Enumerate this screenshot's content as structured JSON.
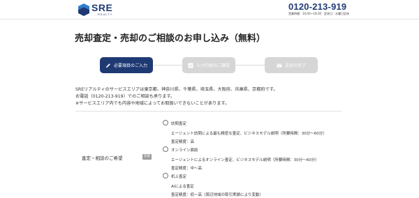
{
  "header": {
    "logo_text": "SRE",
    "logo_sub": "REALTY",
    "tel_number": "0120-213-919",
    "tel_hours": "営業時間：10:00〜18:30　定休日：水曜日定休"
  },
  "page_title": "売却査定・売却のご相談のお申し込み（無料）",
  "steps": [
    {
      "label": "必要項目のご入力",
      "icon": "pencil-icon",
      "active": true
    },
    {
      "label": "入力内容のご確認",
      "icon": "check-icon",
      "active": false
    },
    {
      "label": "送信の完了",
      "icon": "mail-icon",
      "active": false
    }
  ],
  "intro": {
    "line1": "SREリアルティのサービスエリアは東京都、神奈川県、千葉県、埼玉県、大阪府、兵庫県、京都府です。",
    "line2": "お電話（0120-213-919）でのご相談も承ります。",
    "line3": "※サービスエリア内でも内容や地域によってお取扱いできないことがあります。"
  },
  "form": {
    "field_label": "査定・相談のご希望",
    "required_badge": "任意",
    "options": [
      {
        "title": "訪問査定",
        "desc": "エージェント訪問による最も精密な査定、ビジネスモデル説明（所要時間：30分〜60分）",
        "accuracy": "査定精度：高"
      },
      {
        "title": "オンライン面談",
        "desc": "エージェントによるオンライン査定、ビジネスモデル説明（所要時間：30分〜60分）",
        "accuracy": "査定精度：中〜高"
      },
      {
        "title": "机上査定",
        "desc": "AIによる査定",
        "accuracy": "査定精度：低〜高（周辺地域の取引実績により変動）"
      }
    ]
  },
  "colors": {
    "brand": "#1f3a73",
    "inactive_step": "#d6d6d6"
  }
}
